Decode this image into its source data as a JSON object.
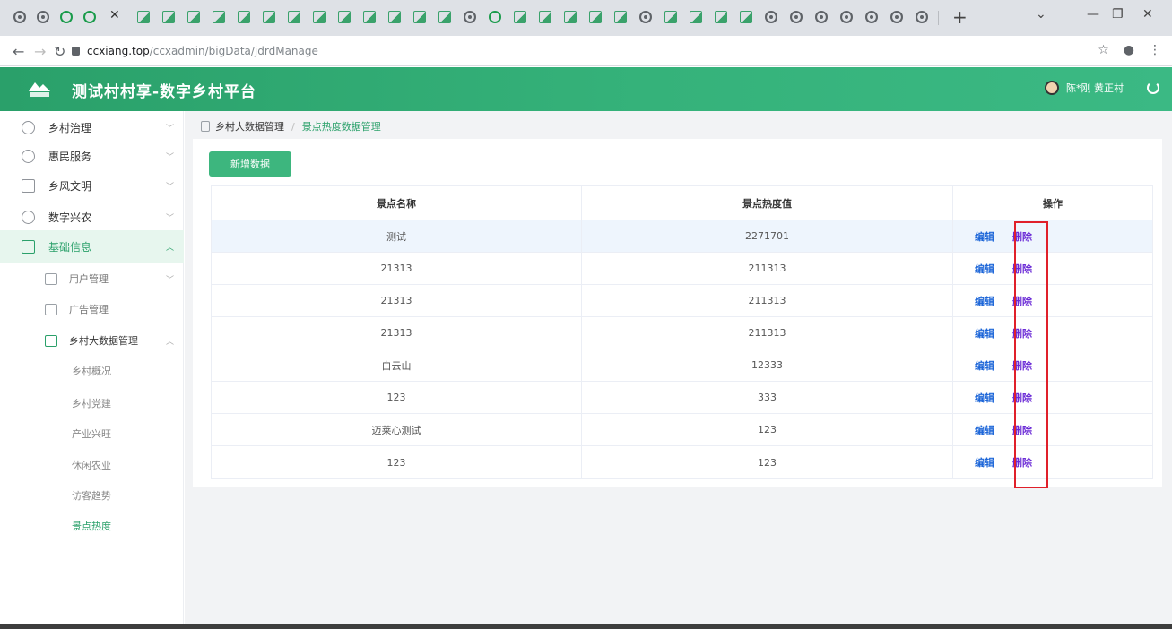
{
  "browser": {
    "url_host": "ccxiang.top",
    "url_path": "/ccxadmin/bigData/jdrdManage"
  },
  "app": {
    "title": "测试村村享-数字乡村平台",
    "user_name": "陈*刚 黄正村"
  },
  "sidebar": {
    "menu": [
      {
        "label": "乡村治理"
      },
      {
        "label": "惠民服务"
      },
      {
        "label": "乡风文明"
      },
      {
        "label": "数字兴农"
      },
      {
        "label": "基础信息"
      }
    ],
    "sub": [
      {
        "label": "用户管理"
      },
      {
        "label": "广告管理"
      },
      {
        "label": "乡村大数据管理"
      }
    ],
    "leaves": [
      {
        "label": "乡村概况"
      },
      {
        "label": "乡村党建"
      },
      {
        "label": "产业兴旺"
      },
      {
        "label": "休闲农业"
      },
      {
        "label": "访客趋势"
      },
      {
        "label": "景点热度"
      }
    ]
  },
  "breadcrumb": {
    "parent": "乡村大数据管理",
    "current": "景点热度数据管理"
  },
  "toolbar": {
    "add_label": "新增数据"
  },
  "table": {
    "headers": [
      "景点名称",
      "景点热度值",
      "操作"
    ],
    "edit_label": "编辑",
    "delete_label": "删除",
    "rows": [
      {
        "name": "测试",
        "value": "2271701"
      },
      {
        "name": "21313",
        "value": "211313"
      },
      {
        "name": "21313",
        "value": "211313"
      },
      {
        "name": "21313",
        "value": "211313"
      },
      {
        "name": "白云山",
        "value": "12333"
      },
      {
        "name": "123",
        "value": "333"
      },
      {
        "name": "迈莱心测试",
        "value": "123"
      },
      {
        "name": "123",
        "value": "123"
      }
    ]
  },
  "colors": {
    "brand_green": "#2aa06a",
    "edit_blue": "#1d66d8",
    "delete_purple": "#6b2bd6",
    "highlight_red": "#e0202a"
  }
}
